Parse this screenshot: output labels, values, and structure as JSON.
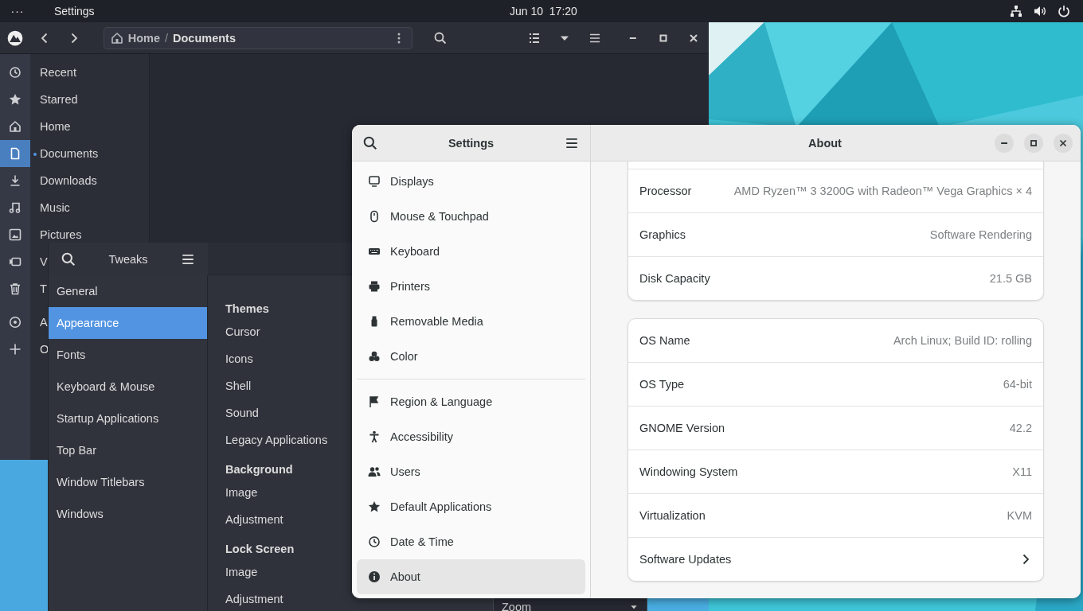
{
  "top_bar": {
    "activities": "···",
    "app_menu": "Settings",
    "clock": "Jun 10  17:20"
  },
  "files": {
    "path": [
      "Home",
      "Documents"
    ],
    "path_separator": "/",
    "places": [
      {
        "label": "Recent",
        "selected": false
      },
      {
        "label": "Starred",
        "selected": false
      },
      {
        "label": "Home",
        "selected": false
      },
      {
        "label": "Documents",
        "selected": true
      },
      {
        "label": "Downloads",
        "selected": false
      },
      {
        "label": "Music",
        "selected": false
      },
      {
        "label": "Pictures",
        "selected": false
      },
      {
        "label": "V",
        "selected": false
      },
      {
        "label": "T",
        "selected": false
      },
      {
        "label": "A",
        "selected": false
      },
      {
        "label": "O",
        "selected": false
      }
    ]
  },
  "tweaks": {
    "title": "Tweaks",
    "sections": [
      {
        "label": "General",
        "selected": false
      },
      {
        "label": "Appearance",
        "selected": true
      },
      {
        "label": "Fonts",
        "selected": false
      },
      {
        "label": "Keyboard & Mouse",
        "selected": false
      },
      {
        "label": "Startup Applications",
        "selected": false
      },
      {
        "label": "Top Bar",
        "selected": false
      },
      {
        "label": "Window Titlebars",
        "selected": false
      },
      {
        "label": "Windows",
        "selected": false
      }
    ],
    "groups": [
      {
        "heading": "Themes",
        "items": [
          "Cursor",
          "Icons",
          "Shell",
          "Sound",
          "Legacy Applications"
        ]
      },
      {
        "heading": "Background",
        "items": [
          "Image",
          "Adjustment"
        ]
      },
      {
        "heading": "Lock Screen",
        "items": [
          "Image",
          "Adjustment"
        ]
      }
    ],
    "dropdown": "Zoom"
  },
  "settings": {
    "title": "Settings",
    "panel_title": "About",
    "nav": [
      [
        {
          "label": "Displays",
          "selected": false
        },
        {
          "label": "Mouse & Touchpad",
          "selected": false
        },
        {
          "label": "Keyboard",
          "selected": false
        },
        {
          "label": "Printers",
          "selected": false
        },
        {
          "label": "Removable Media",
          "selected": false
        },
        {
          "label": "Color",
          "selected": false
        }
      ],
      [
        {
          "label": "Region & Language",
          "selected": false
        },
        {
          "label": "Accessibility",
          "selected": false
        },
        {
          "label": "Users",
          "selected": false
        },
        {
          "label": "Default Applications",
          "selected": false
        },
        {
          "label": "Date & Time",
          "selected": false
        },
        {
          "label": "About",
          "selected": true
        }
      ]
    ],
    "info_groups": [
      [
        {
          "label": "Processor",
          "value": "AMD Ryzen™ 3 3200G with Radeon™ Vega Graphics × 4",
          "kind": "info"
        },
        {
          "label": "Graphics",
          "value": "Software Rendering",
          "kind": "info"
        },
        {
          "label": "Disk Capacity",
          "value": "21.5 GB",
          "kind": "info"
        }
      ],
      [
        {
          "label": "OS Name",
          "value": "Arch Linux; Build ID: rolling",
          "kind": "info"
        },
        {
          "label": "OS Type",
          "value": "64-bit",
          "kind": "info"
        },
        {
          "label": "GNOME Version",
          "value": "42.2",
          "kind": "info"
        },
        {
          "label": "Windowing System",
          "value": "X11",
          "kind": "info"
        },
        {
          "label": "Virtualization",
          "value": "KVM",
          "kind": "info"
        },
        {
          "label": "Software Updates",
          "kind": "link"
        }
      ]
    ]
  }
}
